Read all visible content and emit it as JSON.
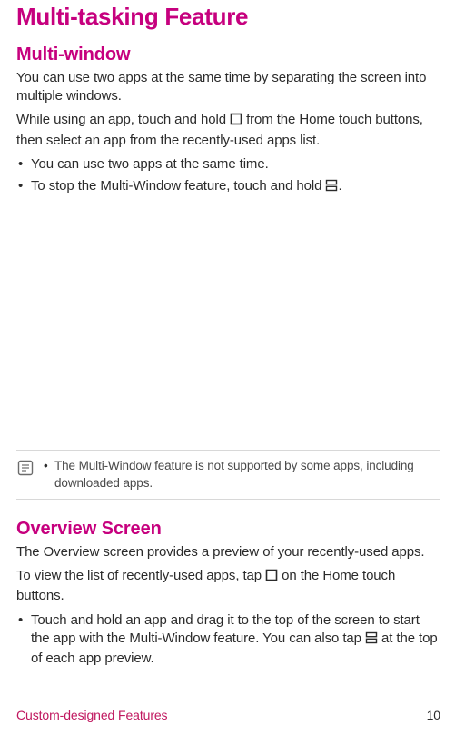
{
  "title": "Multi-tasking Feature",
  "section1": {
    "heading": "Multi-window",
    "p1": "You can use two apps at the same time by separating the screen into multiple windows.",
    "p2a": "While using an app, touch and hold ",
    "p2b": " from the Home touch buttons, then select an app from the recently-used apps list.",
    "b1": "You can use two apps at the same time.",
    "b2a": "To stop the Multi-Window feature, touch and hold ",
    "b2b": "."
  },
  "note": {
    "text": "The Multi-Window feature is not supported by some apps, including downloaded apps."
  },
  "section2": {
    "heading": "Overview Screen",
    "p1": "The Overview screen provides a preview of your recently-used apps.",
    "p2a": "To view the list of recently-used apps, tap ",
    "p2b": " on the Home touch buttons.",
    "b1a": "Touch and hold an app and drag it to the top of the screen to start the app with the Multi-Window feature. You can also tap ",
    "b1b": " at the top of each app preview."
  },
  "footer": {
    "left": "Custom-designed Features",
    "right": "10"
  },
  "icons": {
    "square": "square-icon",
    "split": "split-icon",
    "note": "note-icon"
  }
}
